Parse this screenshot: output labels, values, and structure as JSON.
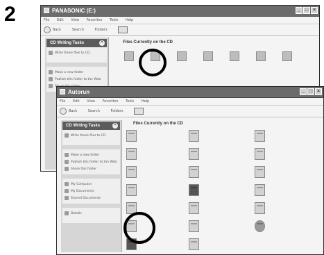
{
  "step": "2",
  "back_window": {
    "title": "PANASONIC (E:)",
    "menu": [
      "File",
      "Edit",
      "View",
      "Favorites",
      "Tools",
      "Help"
    ],
    "toolbar": [
      "Back",
      "Search",
      "Folders"
    ],
    "pane": {
      "header": "CD Writing Tasks",
      "sections": [
        {
          "items": [
            "Write these files to CD"
          ]
        },
        {
          "items": [
            "Make a new folder",
            "Publish this folder to the Web",
            "Share this folder"
          ]
        }
      ]
    },
    "content_title": "Files Currently on the CD",
    "files": [
      "",
      "",
      "",
      "",
      "",
      "",
      ""
    ]
  },
  "front_window": {
    "title": "Autorun",
    "menu": [
      "File",
      "Edit",
      "View",
      "Favorites",
      "Tools",
      "Help"
    ],
    "toolbar": [
      "Back",
      "Search",
      "Folders"
    ],
    "pane": {
      "header": "CD Writing Tasks",
      "sections": [
        {
          "items": [
            "Write these files to CD"
          ]
        },
        {
          "items": [
            "Make a new folder",
            "Publish this folder to the Web",
            "Share this folder"
          ]
        },
        {
          "items": [
            "My Computer",
            "My Documents",
            "Shared Documents"
          ]
        },
        {
          "items": [
            "Details"
          ]
        }
      ]
    },
    "content_title": "Files Currently on the CD",
    "files": []
  },
  "icons": {
    "app": "folder-icon",
    "highlight": "ring-marker",
    "target_file": "install-program-icon"
  }
}
